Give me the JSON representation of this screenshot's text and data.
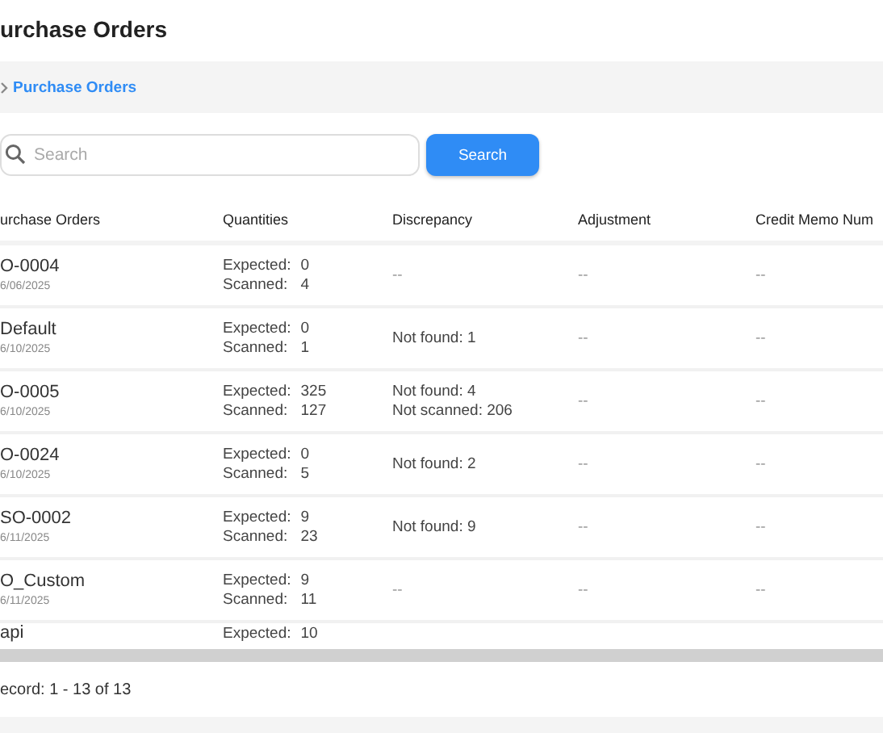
{
  "page_title": "urchase Orders",
  "breadcrumb": {
    "label": "Purchase Orders"
  },
  "search": {
    "placeholder": "Search",
    "button": "Search"
  },
  "table": {
    "columns": [
      "urchase Orders",
      "Quantities",
      "Discrepancy",
      "Adjustment",
      "Credit Memo Num"
    ],
    "rows": [
      {
        "order": "O-0004",
        "date": "6/06/2025",
        "expected_label": "Expected:",
        "expected": "0",
        "scanned_label": "Scanned:",
        "scanned": "4",
        "discrepancy": [
          "--"
        ],
        "adjustment": "--",
        "credit_memo": "--"
      },
      {
        "order": "Default",
        "date": "6/10/2025",
        "expected_label": "Expected:",
        "expected": "0",
        "scanned_label": "Scanned:",
        "scanned": "1",
        "discrepancy": [
          "Not found: 1"
        ],
        "adjustment": "--",
        "credit_memo": "--"
      },
      {
        "order": "O-0005",
        "date": "6/10/2025",
        "expected_label": "Expected:",
        "expected": "325",
        "scanned_label": "Scanned:",
        "scanned": "127",
        "discrepancy": [
          "Not found: 4",
          "Not scanned: 206"
        ],
        "adjustment": "--",
        "credit_memo": "--"
      },
      {
        "order": "O-0024",
        "date": "6/10/2025",
        "expected_label": "Expected:",
        "expected": "0",
        "scanned_label": "Scanned:",
        "scanned": "5",
        "discrepancy": [
          "Not found: 2"
        ],
        "adjustment": "--",
        "credit_memo": "--"
      },
      {
        "order": "SO-0002",
        "date": "6/11/2025",
        "expected_label": "Expected:",
        "expected": "9",
        "scanned_label": "Scanned:",
        "scanned": "23",
        "discrepancy": [
          "Not found: 9"
        ],
        "adjustment": "--",
        "credit_memo": "--"
      },
      {
        "order": "O_Custom",
        "date": "6/11/2025",
        "expected_label": "Expected:",
        "expected": "9",
        "scanned_label": "Scanned:",
        "scanned": "11",
        "discrepancy": [
          "--"
        ],
        "adjustment": "--",
        "credit_memo": "--"
      },
      {
        "order": "api",
        "expected_label": "Expected:",
        "expected": "10"
      }
    ]
  },
  "footer": {
    "record_count": "ecord: 1 - 13 of 13"
  }
}
